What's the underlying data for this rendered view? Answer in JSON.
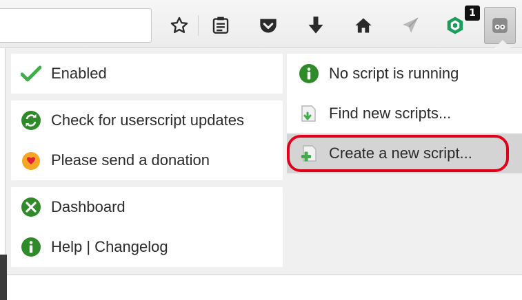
{
  "toolbar": {
    "icons": [
      "star-icon",
      "reading-list-icon",
      "pocket-icon",
      "download-icon",
      "home-icon",
      "send-icon",
      "extension-shield-icon",
      "greasemonkey-icon"
    ],
    "badge_count": "1"
  },
  "menu": {
    "left_groups": [
      {
        "items": [
          {
            "label": "Enabled",
            "icon": "checkmark-icon"
          }
        ]
      },
      {
        "items": [
          {
            "label": "Check for userscript updates",
            "icon": "refresh-icon"
          },
          {
            "label": "Please send a donation",
            "icon": "heart-icon"
          }
        ]
      },
      {
        "items": [
          {
            "label": "Dashboard",
            "icon": "dashboard-icon"
          },
          {
            "label": "Help | Changelog",
            "icon": "info-icon"
          }
        ]
      }
    ],
    "right_items": [
      {
        "label": "No script is running",
        "icon": "info-icon"
      },
      {
        "label": "Find new scripts...",
        "icon": "find-scripts-icon"
      },
      {
        "label": "Create a new script...",
        "icon": "create-script-icon",
        "highlighted": true
      }
    ]
  },
  "colors": {
    "highlight_ring": "#e0001b",
    "menu_bg": "#f0f0f0",
    "item_hover": "#d4d4d4"
  }
}
